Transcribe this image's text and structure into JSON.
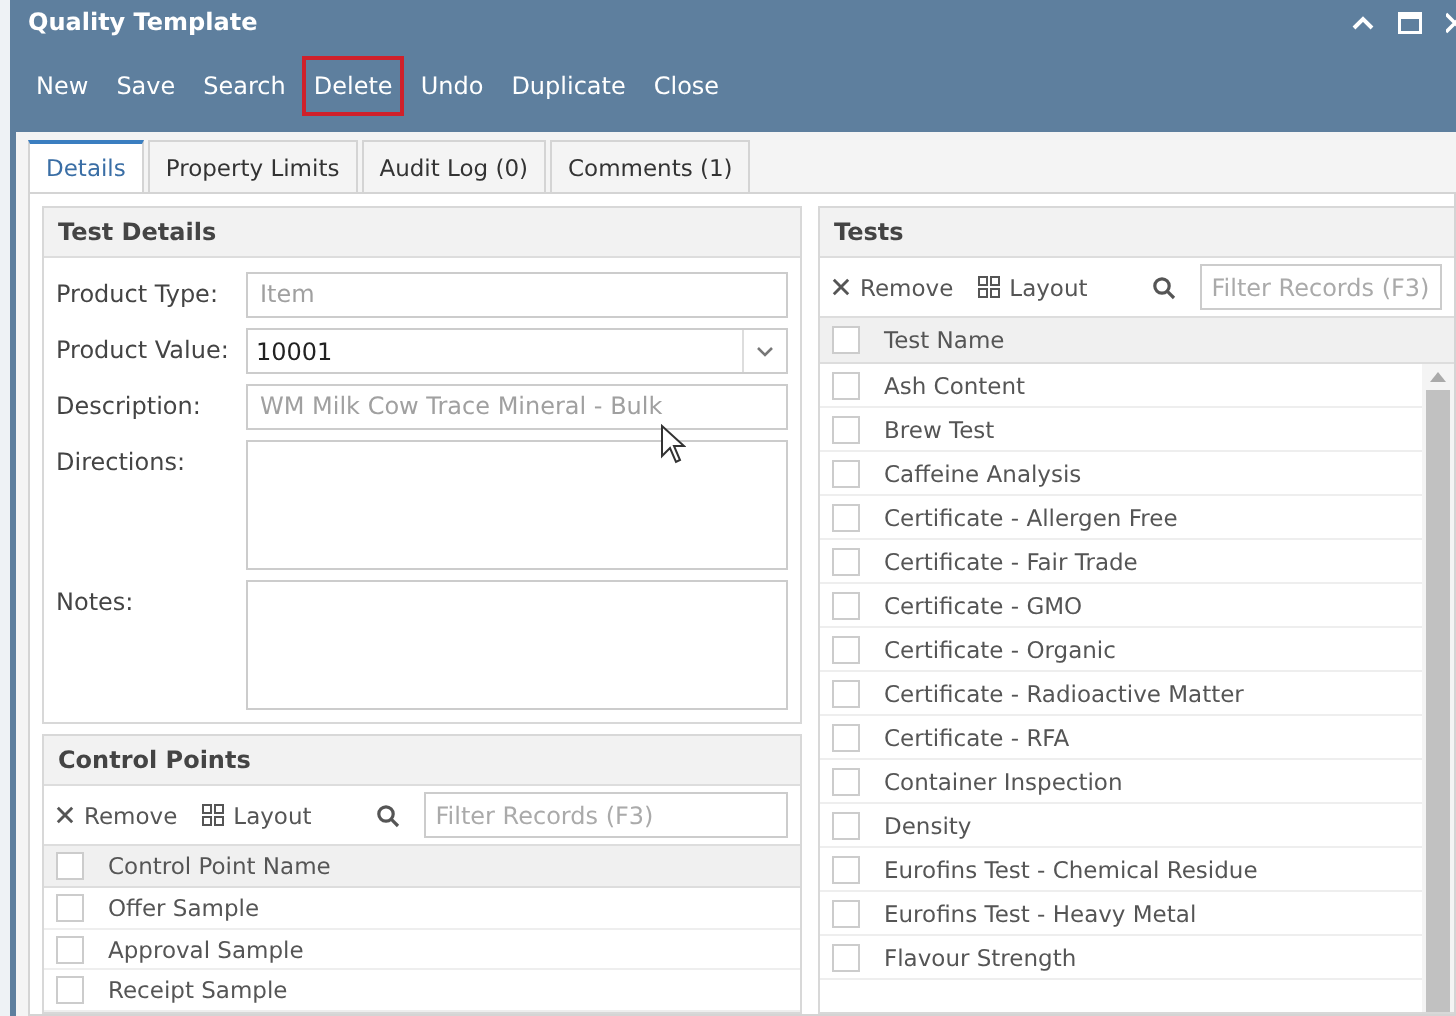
{
  "window": {
    "title": "Quality Template"
  },
  "toolbar": [
    {
      "label": "New",
      "highlighted": false
    },
    {
      "label": "Save",
      "highlighted": false
    },
    {
      "label": "Search",
      "highlighted": false
    },
    {
      "label": "Delete",
      "highlighted": true
    },
    {
      "label": "Undo",
      "highlighted": false
    },
    {
      "label": "Duplicate",
      "highlighted": false
    },
    {
      "label": "Close",
      "highlighted": false
    }
  ],
  "tabs": [
    {
      "label": "Details",
      "selected": true
    },
    {
      "label": "Property Limits",
      "selected": false
    },
    {
      "label": "Audit Log (0)",
      "selected": false
    },
    {
      "label": "Comments (1)",
      "selected": false
    }
  ],
  "test_details": {
    "title": "Test Details",
    "fields": [
      {
        "kind": "text",
        "label": "Product Type:",
        "value": "Item",
        "disabled": true
      },
      {
        "kind": "combo",
        "label": "Product Value:",
        "value": "10001"
      },
      {
        "kind": "text",
        "label": "Description:",
        "value": "WM Milk Cow Trace Mineral - Bulk",
        "disabled": true
      },
      {
        "kind": "area",
        "label": "Directions:"
      },
      {
        "kind": "area",
        "label": "Notes:"
      }
    ]
  },
  "control_points": {
    "title": "Control Points",
    "remove": "Remove",
    "layout": "Layout",
    "filter_placeholder": "Filter Records (F3)",
    "column": "Control Point Name",
    "all_checked": false,
    "rows": [
      {
        "name": "Offer Sample",
        "checked": false
      },
      {
        "name": "Approval Sample",
        "checked": false
      },
      {
        "name": "Receipt Sample",
        "checked": false
      }
    ]
  },
  "tests": {
    "title": "Tests",
    "remove": "Remove",
    "layout": "Layout",
    "filter_placeholder": "Filter Records (F3)",
    "column": "Test Name",
    "all_checked": false,
    "rows": [
      {
        "name": "Ash Content",
        "checked": false
      },
      {
        "name": "Brew Test",
        "checked": false
      },
      {
        "name": "Caffeine Analysis",
        "checked": false
      },
      {
        "name": "Certificate - Allergen Free",
        "checked": false
      },
      {
        "name": "Certificate - Fair Trade",
        "checked": false
      },
      {
        "name": "Certificate - GMO",
        "checked": false
      },
      {
        "name": "Certificate - Organic",
        "checked": false
      },
      {
        "name": "Certificate - Radioactive Matter",
        "checked": false
      },
      {
        "name": "Certificate - RFA",
        "checked": false
      },
      {
        "name": "Container Inspection",
        "checked": false
      },
      {
        "name": "Density",
        "checked": false
      },
      {
        "name": "Eurofins Test - Chemical Residue",
        "checked": false
      },
      {
        "name": "Eurofins Test - Heavy Metal",
        "checked": false
      },
      {
        "name": "Flavour Strength",
        "checked": false
      }
    ]
  }
}
